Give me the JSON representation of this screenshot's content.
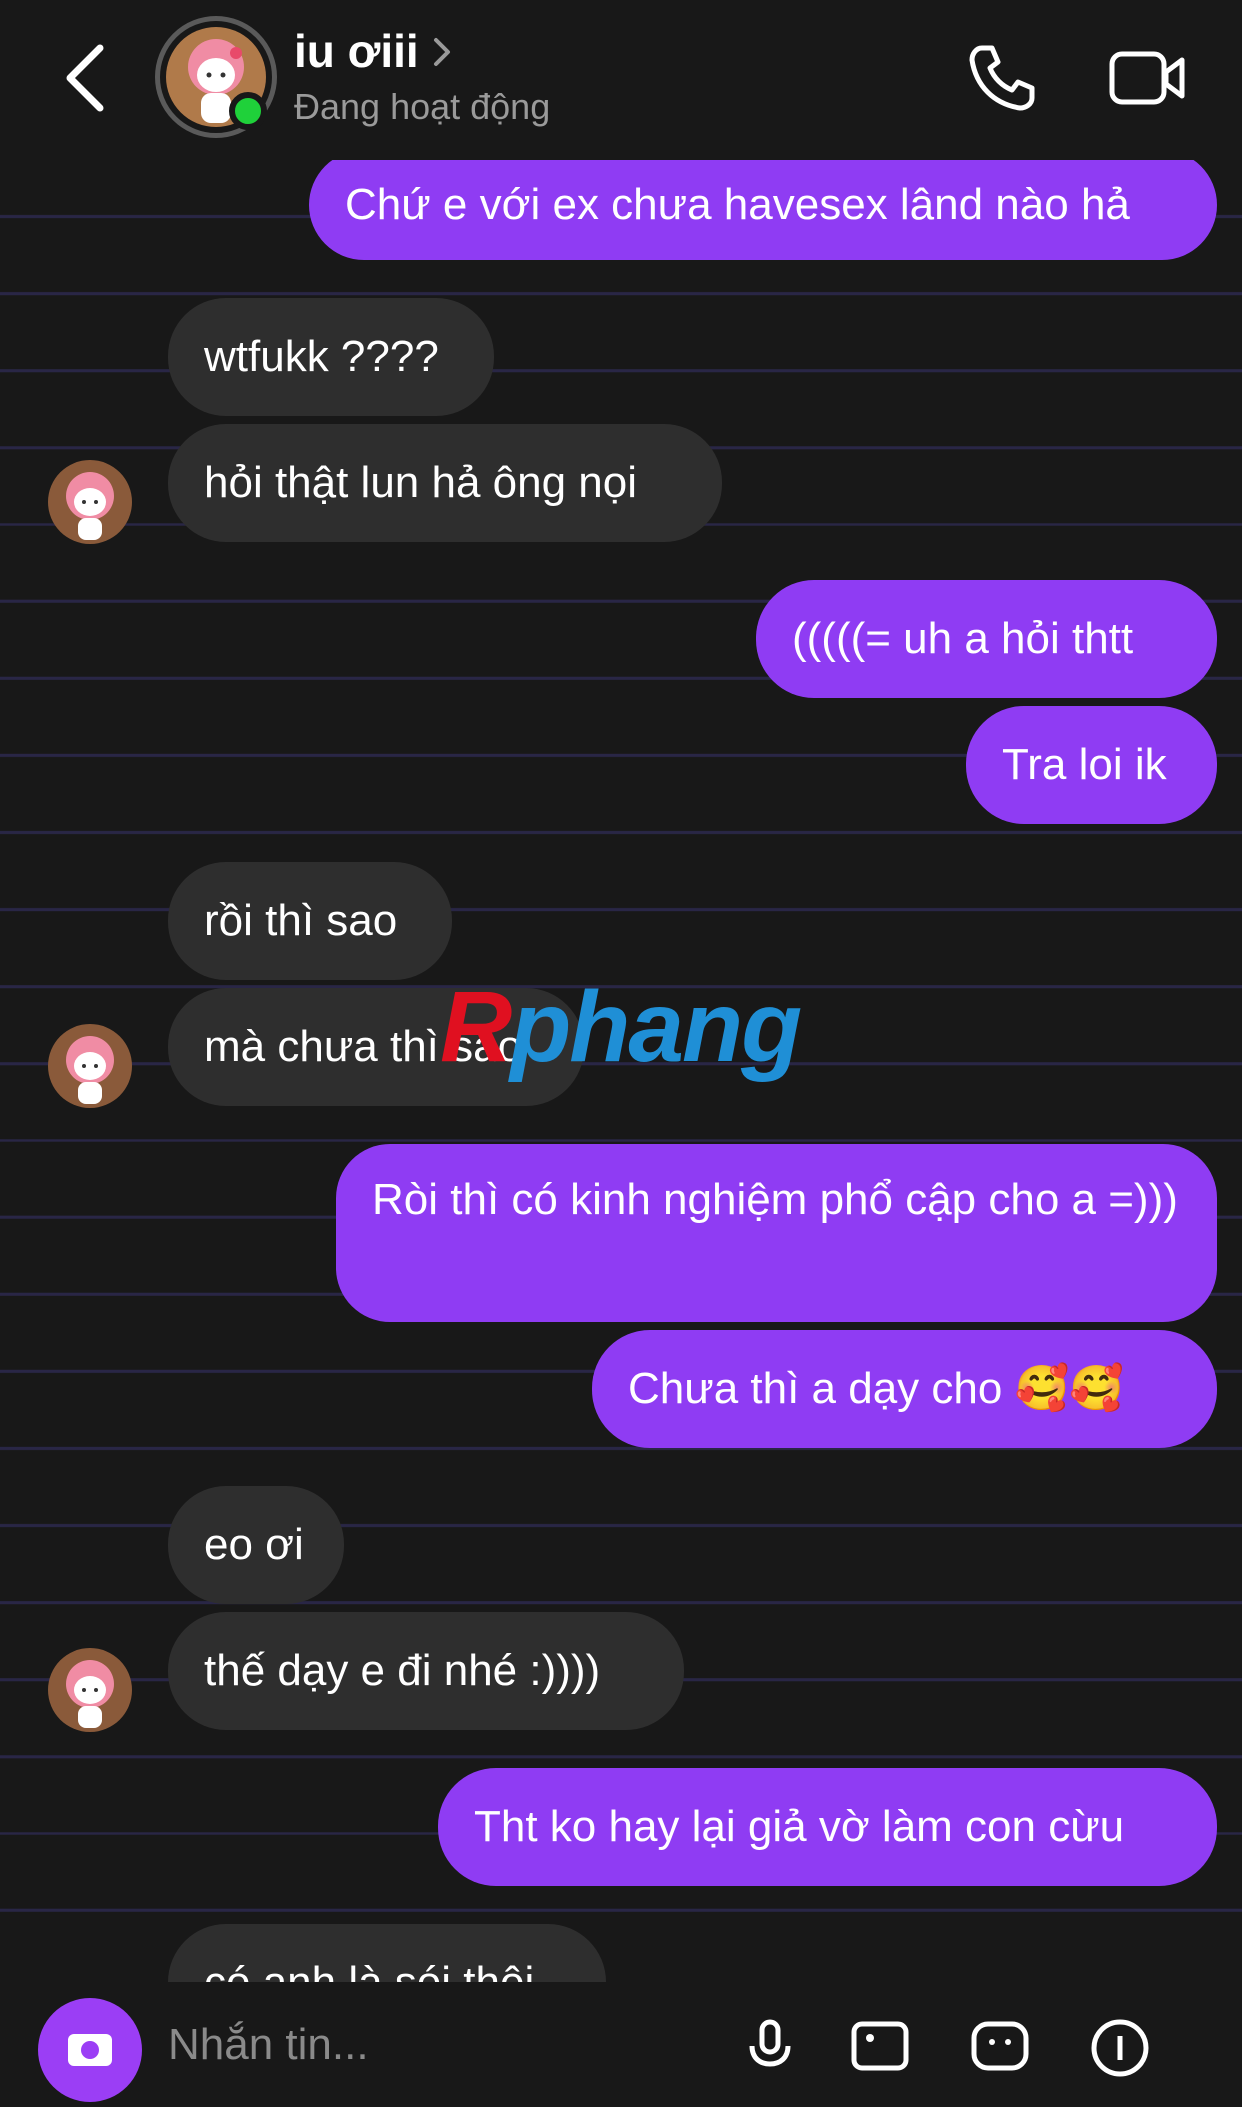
{
  "header": {
    "name": "iu ơiii",
    "status": "Đang hoạt động"
  },
  "messages": [
    {
      "from": "me",
      "text": "Chứ e với ex chưa havesex lând nào hả"
    },
    {
      "from": "them",
      "text": "wtfukk ????"
    },
    {
      "from": "them",
      "text": "hỏi thật lun hả ông nọi"
    },
    {
      "from": "me",
      "text": "(((((= uh a hỏi thtt"
    },
    {
      "from": "me",
      "text": "Tra loi ik"
    },
    {
      "from": "them",
      "text": "rồi thì sao"
    },
    {
      "from": "them",
      "text": "mà chưa thì sao"
    },
    {
      "from": "me",
      "text": "Ròi thì có kinh nghiệm phổ cập cho a =)))"
    },
    {
      "from": "me",
      "text": "Chưa thì a dạy cho 🥰🥰"
    },
    {
      "from": "them",
      "text": "eo ơi"
    },
    {
      "from": "them",
      "text": "thế dạy e đi nhé :))))"
    },
    {
      "from": "me",
      "text": "Tht ko hay lại giả vờ làm con cừu"
    },
    {
      "from": "them",
      "text": "có anh là sói thôi"
    }
  ],
  "watermark": {
    "first": "R",
    "rest": "phang"
  },
  "composer": {
    "placeholder": "Nhắn tin..."
  },
  "colors": {
    "outgoing": "#8f3cf3",
    "incoming": "#2e2e2e",
    "background": "#181818",
    "online": "#1fd13a"
  },
  "icons": [
    "back-chevron-icon",
    "phone-icon",
    "video-camera-icon",
    "camera-icon",
    "microphone-icon",
    "image-icon",
    "sticker-icon",
    "plus-circle-icon"
  ]
}
